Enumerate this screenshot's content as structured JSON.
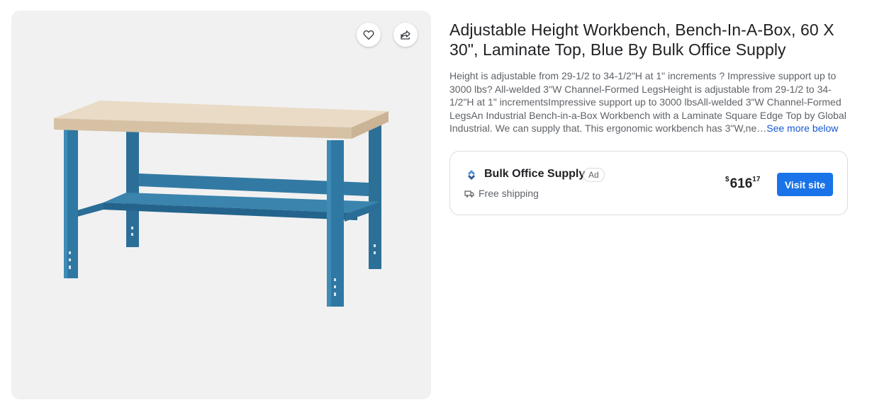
{
  "product": {
    "title": "Adjustable Height Workbench, Bench-In-A-Box, 60 X 30\", Laminate Top, Blue By Bulk Office Supply",
    "description": "Height is adjustable from 29-1/2 to 34-1/2\"H at 1\" increments ? Impressive support up to 3000 lbs? All-welded 3\"W Channel-Formed LegsHeight is adjustable from 29-1/2 to 34-1/2\"H at 1\" incrementsImpressive support up to 3000 lbsAll-welded 3\"W Channel-Formed LegsAn Industrial Bench-in-a-Box Workbench with a Laminate Square Edge Top by Global Industrial. We can supply that. This ergonomic workbench has 3\"W,ne…",
    "see_more_label": "See more below"
  },
  "image_actions": {
    "favorite_icon": "heart-icon",
    "share_icon": "share-icon"
  },
  "offer": {
    "seller_name": "Bulk Office Supply",
    "ad_label": "Ad",
    "shipping_text": "Free shipping",
    "price_currency": "$",
    "price_whole": "616",
    "price_cents": "17",
    "visit_label": "Visit site"
  },
  "colors": {
    "accent": "#1a73e8",
    "bench_blue": "#2f78a3",
    "bench_top": "#e8d8c2"
  }
}
